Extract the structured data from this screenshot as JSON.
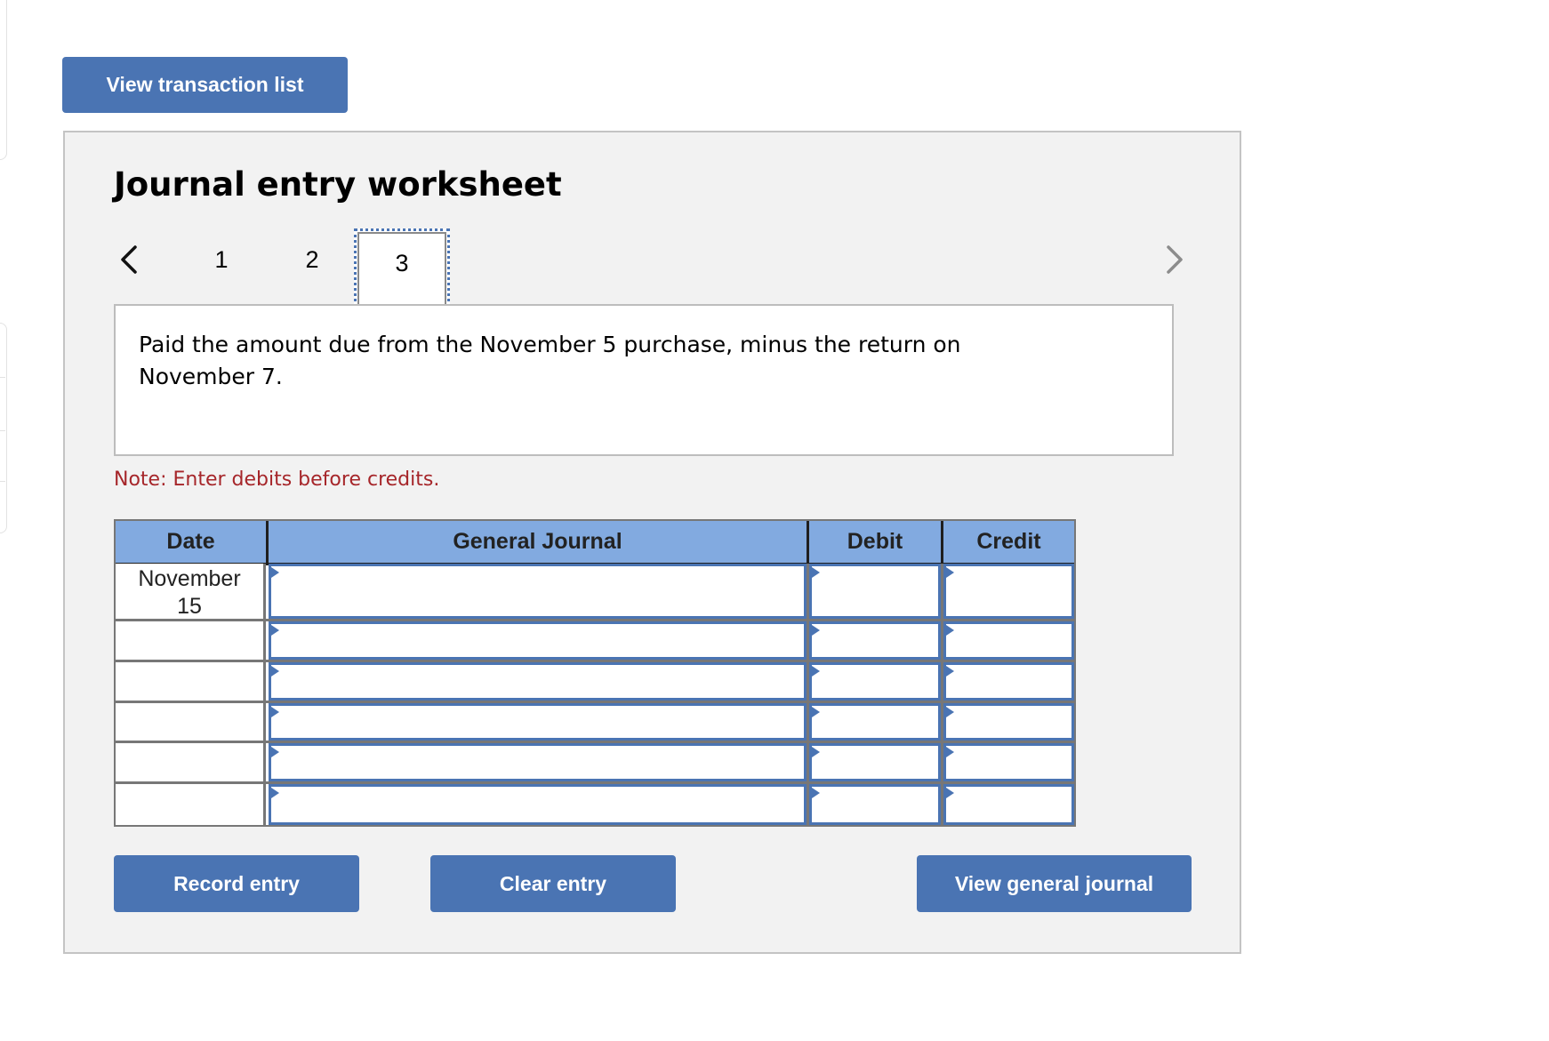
{
  "toolbar": {
    "view_transaction_list_label": "View transaction list"
  },
  "worksheet": {
    "title": "Journal entry worksheet",
    "tabs": [
      {
        "label": "1",
        "active": false
      },
      {
        "label": "2",
        "active": false
      },
      {
        "label": "3",
        "active": true
      }
    ],
    "prev_icon": "chevron-left-icon",
    "next_icon": "chevron-right-icon",
    "description": "Paid the amount due from the November 5 purchase, minus the return on November 7.",
    "note": "Note: Enter debits before credits.",
    "colors": {
      "button": "#4a74b3",
      "header": "#82aae0",
      "note": "#a6262a",
      "panel": "#f2f2f2"
    }
  },
  "journal_table": {
    "headers": {
      "date": "Date",
      "general_journal": "General Journal",
      "debit": "Debit",
      "credit": "Credit"
    },
    "rows": [
      {
        "date": "November\n15",
        "account": "",
        "debit": "",
        "credit": ""
      },
      {
        "date": "",
        "account": "",
        "debit": "",
        "credit": ""
      },
      {
        "date": "",
        "account": "",
        "debit": "",
        "credit": ""
      },
      {
        "date": "",
        "account": "",
        "debit": "",
        "credit": ""
      },
      {
        "date": "",
        "account": "",
        "debit": "",
        "credit": ""
      },
      {
        "date": "",
        "account": "",
        "debit": "",
        "credit": ""
      }
    ]
  },
  "actions": {
    "record_entry": "Record entry",
    "clear_entry": "Clear entry",
    "view_general_journal": "View general journal"
  }
}
